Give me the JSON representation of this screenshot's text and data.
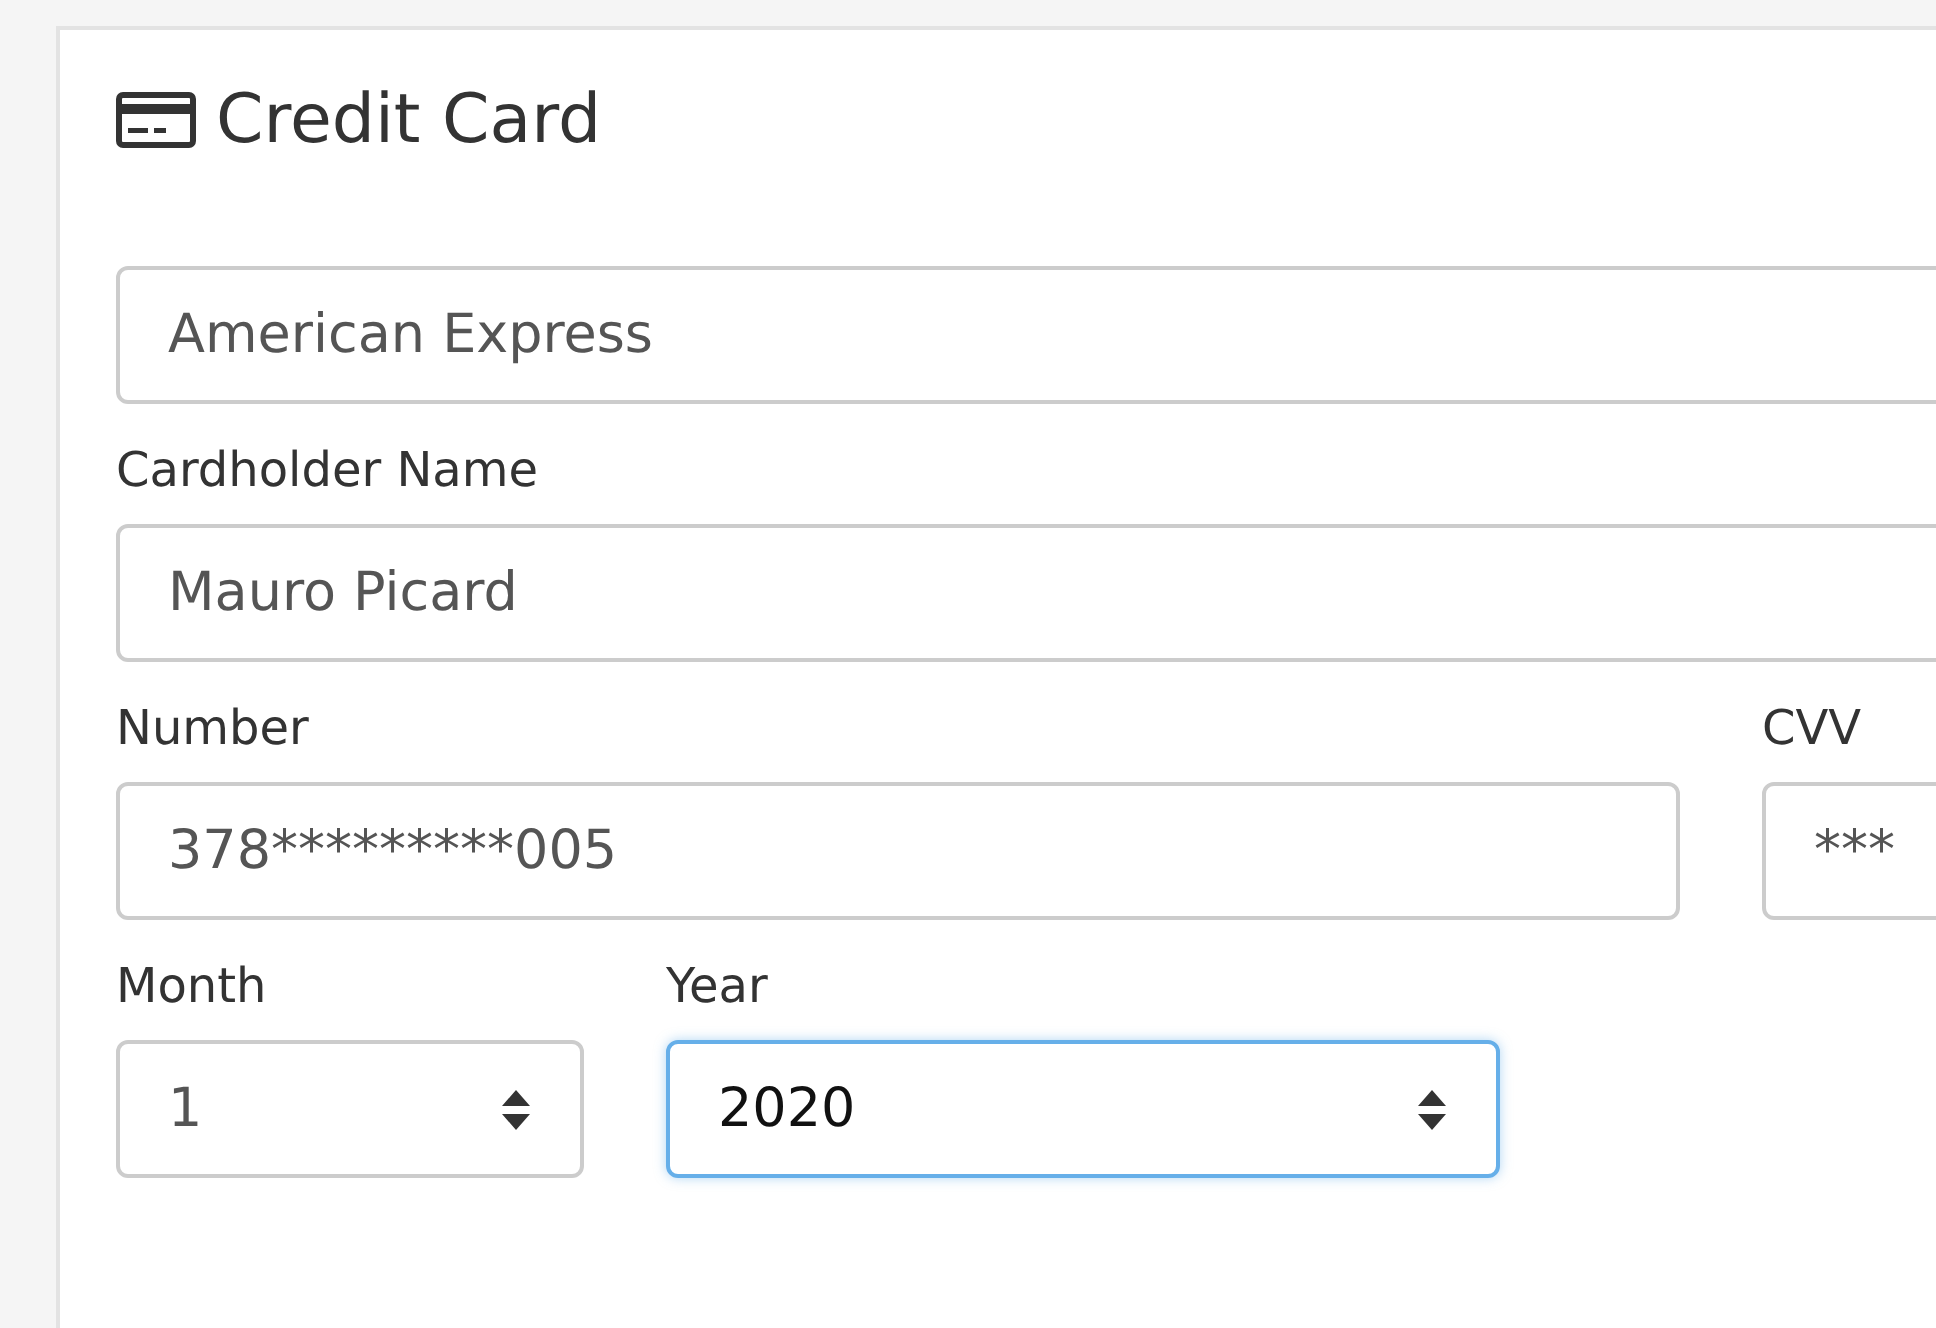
{
  "panel": {
    "title": "Credit Card"
  },
  "card_type": {
    "kind": "input",
    "value": "American Express",
    "focused": false
  },
  "cardholder": {
    "label": "Cardholder Name",
    "field": {
      "kind": "input",
      "value": "Mauro Picard",
      "focused": false
    }
  },
  "number": {
    "label": "Number",
    "field": {
      "kind": "input",
      "value": "378*********005",
      "focused": false
    }
  },
  "cvv": {
    "label": "CVV",
    "field": {
      "kind": "input",
      "value": "***",
      "focused": false
    }
  },
  "month": {
    "label": "Month",
    "field": {
      "kind": "select",
      "value": "1",
      "focused": false
    }
  },
  "year": {
    "label": "Year",
    "field": {
      "kind": "select",
      "value": "2020",
      "focused": true
    }
  }
}
